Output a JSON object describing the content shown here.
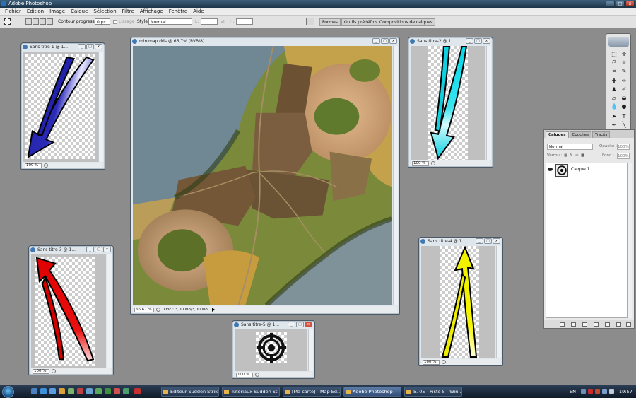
{
  "app": {
    "title": "Adobe Photoshop"
  },
  "window_controls": {
    "minimize": "_",
    "maximize": "□",
    "close": "x"
  },
  "menu": [
    "Fichier",
    "Edition",
    "Image",
    "Calque",
    "Sélection",
    "Filtre",
    "Affichage",
    "Fenêtre",
    "Aide"
  ],
  "options": {
    "feather_label": "Contour progressif :",
    "feather_value": "0 px",
    "antialias_label": "Lissage",
    "style_label": "Style:",
    "style_value": "Normal",
    "width_label": "L:",
    "height_label": "H:",
    "panel_tabs": [
      "Formes",
      "Outils prédéfins",
      "Compositions de calques"
    ]
  },
  "documents": {
    "t1": {
      "title": "Sans titre-1 @ 1...",
      "zoom": "100 %",
      "arrow_color": "#1a1aa8"
    },
    "minimap": {
      "title": "minimap.dds @ 66,7% (RVB/8)",
      "zoom": "66,67 %",
      "doc_info": "Doc : 3,00 Mo/3,00 Mo"
    },
    "t2": {
      "title": "Sans titre-2 @ 1...",
      "zoom": "100 %",
      "arrow_color": "#00d8e8"
    },
    "t3": {
      "title": "Sans titre-3 @ 1...",
      "zoom": "100 %",
      "arrow_color": "#e00000"
    },
    "t4": {
      "title": "Sans titre-4 @ 1...",
      "zoom": "100 %",
      "arrow_color": "#f0f000"
    },
    "t5": {
      "title": "Sans titre-5 @ 1...",
      "zoom": "100 %"
    }
  },
  "layers_panel": {
    "tabs": [
      "Calques",
      "Couches",
      "Tracés"
    ],
    "blend_mode": "Normal",
    "opacity_label": "Opacité :",
    "opacity_value": "100%",
    "lock_label": "Verrou :",
    "fill_label": "Fond :",
    "fill_value": "100%",
    "layer_name": "Calque 1"
  },
  "taskbar": {
    "tasks": [
      "Editeur Sudden Strik...",
      "Tutoriaux Sudden St...",
      "[Ma carte] - Map Ed...",
      "Adobe Photoshop",
      "5. 05 - Piste 5 - Win..."
    ],
    "active_task": "Adobe Photoshop",
    "language": "EN",
    "clock": "19:57"
  },
  "colors": {
    "taskbar": "#1a2a3d",
    "desktop": "#8c8c8c"
  }
}
